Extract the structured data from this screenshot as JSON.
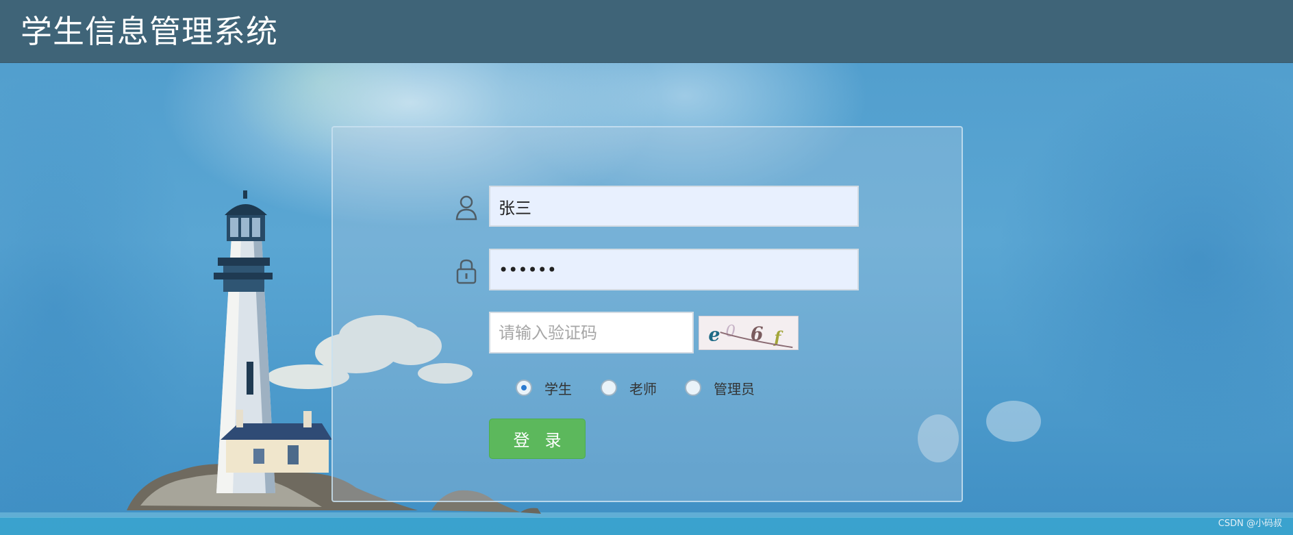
{
  "header": {
    "title": "学生信息管理系统"
  },
  "login": {
    "username": {
      "value": "张三",
      "icon": "user-icon"
    },
    "password": {
      "value": "123456",
      "icon": "lock-icon"
    },
    "captcha": {
      "placeholder": "请输入验证码",
      "image_text": "e06f"
    },
    "roles": [
      {
        "label": "学生",
        "selected": true
      },
      {
        "label": "老师",
        "selected": false
      },
      {
        "label": "管理员",
        "selected": false
      }
    ],
    "submit_label": "登录"
  },
  "watermark": "CSDN @小码叔",
  "colors": {
    "header_bg": "#3f6478",
    "login_button": "#5cb85c",
    "input_bg": "#e8f0fe",
    "radio_accent": "#2b7bd1"
  }
}
